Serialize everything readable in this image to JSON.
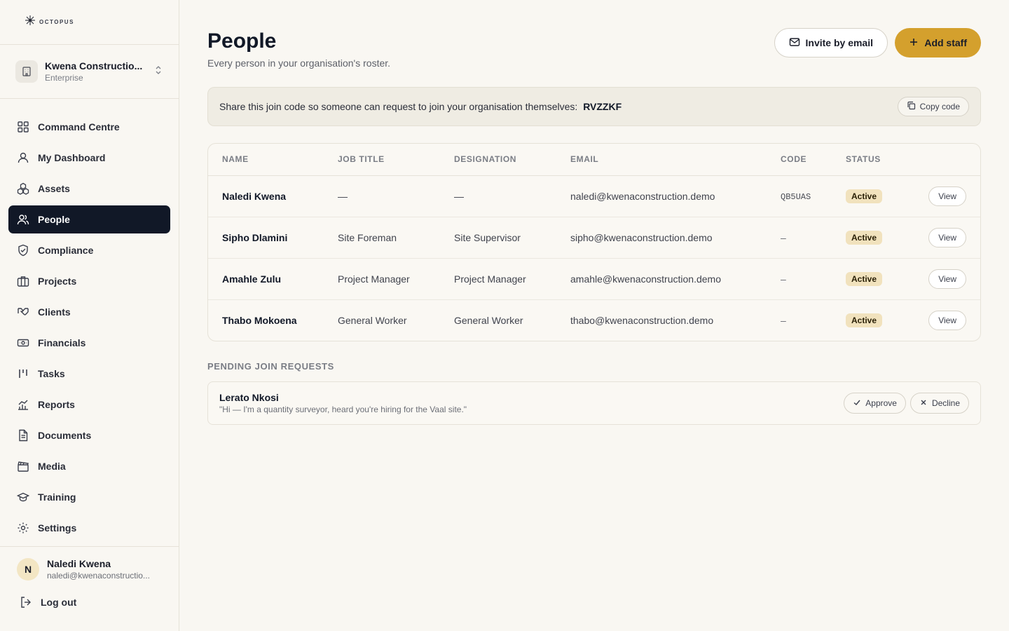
{
  "brand": {
    "name": "OCTOPUS"
  },
  "org": {
    "name": "Kwena Constructio...",
    "plan": "Enterprise"
  },
  "nav": [
    {
      "label": "Command Centre",
      "icon": "grid-icon",
      "active": false
    },
    {
      "label": "My Dashboard",
      "icon": "user-icon",
      "active": false
    },
    {
      "label": "Assets",
      "icon": "cubes-icon",
      "active": false
    },
    {
      "label": "People",
      "icon": "users-icon",
      "active": true
    },
    {
      "label": "Compliance",
      "icon": "shield-check-icon",
      "active": false
    },
    {
      "label": "Projects",
      "icon": "building-icon",
      "active": false
    },
    {
      "label": "Clients",
      "icon": "handshake-icon",
      "active": false
    },
    {
      "label": "Financials",
      "icon": "banknote-icon",
      "active": false
    },
    {
      "label": "Tasks",
      "icon": "kanban-icon",
      "active": false
    },
    {
      "label": "Reports",
      "icon": "chart-icon",
      "active": false
    },
    {
      "label": "Documents",
      "icon": "document-icon",
      "active": false
    },
    {
      "label": "Media",
      "icon": "clapperboard-icon",
      "active": false
    },
    {
      "label": "Training",
      "icon": "graduation-cap-icon",
      "active": false
    },
    {
      "label": "Settings",
      "icon": "gear-icon",
      "active": false
    }
  ],
  "user": {
    "initial": "N",
    "name": "Naledi Kwena",
    "email": "naledi@kwenaconstructio..."
  },
  "logout_label": "Log out",
  "page": {
    "title": "People",
    "subtitle": "Every person in your organisation's roster.",
    "invite_label": "Invite by email",
    "add_label": "Add staff"
  },
  "join": {
    "text": "Share this join code so someone can request to join your organisation themselves:",
    "code": "RVZZKF",
    "copy_label": "Copy code"
  },
  "table": {
    "headers": [
      "NAME",
      "JOB TITLE",
      "DESIGNATION",
      "EMAIL",
      "CODE",
      "STATUS"
    ],
    "rows": [
      {
        "name": "Naledi Kwena",
        "job": "—",
        "designation": "—",
        "email": "naledi@kwenaconstruction.demo",
        "code": "QB5UAS",
        "status": "Active",
        "action": "View"
      },
      {
        "name": "Sipho Dlamini",
        "job": "Site Foreman",
        "designation": "Site Supervisor",
        "email": "sipho@kwenaconstruction.demo",
        "code": "–",
        "status": "Active",
        "action": "View"
      },
      {
        "name": "Amahle Zulu",
        "job": "Project Manager",
        "designation": "Project Manager",
        "email": "amahle@kwenaconstruction.demo",
        "code": "–",
        "status": "Active",
        "action": "View"
      },
      {
        "name": "Thabo Mokoena",
        "job": "General Worker",
        "designation": "General Worker",
        "email": "thabo@kwenaconstruction.demo",
        "code": "–",
        "status": "Active",
        "action": "View"
      }
    ]
  },
  "pending": {
    "title": "PENDING JOIN REQUESTS",
    "requests": [
      {
        "name": "Lerato Nkosi",
        "message": "\"Hi — I'm a quantity surveyor, heard you're hiring for the Vaal site.\"",
        "approve_label": "Approve",
        "decline_label": "Decline"
      }
    ]
  },
  "colors": {
    "accent": "#d4a02d",
    "active_nav": "#111827",
    "badge": "#f1e2bd",
    "background": "#f9f7f2"
  }
}
